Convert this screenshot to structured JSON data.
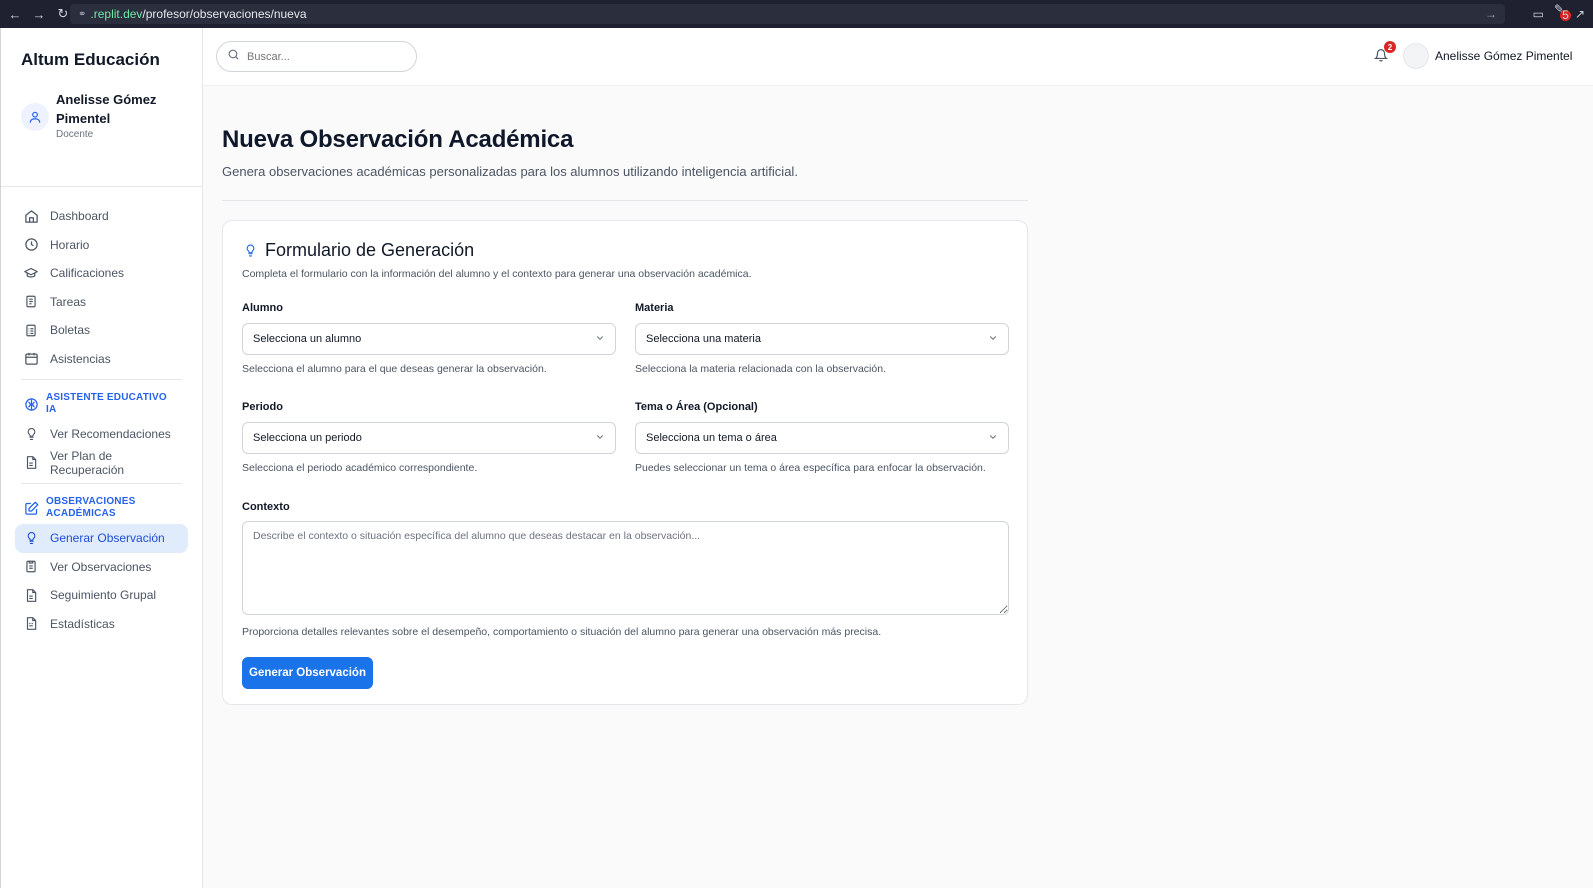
{
  "browser": {
    "url_host": ".replit.dev",
    "url_path": "/profesor/observaciones/nueva",
    "extension_badge": "5"
  },
  "sidebar": {
    "brand": "Altum Educación",
    "profile": {
      "name": "Anelisse Gómez Pimentel",
      "role": "Docente"
    },
    "main_items": [
      {
        "label": "Dashboard",
        "icon": "home-icon"
      },
      {
        "label": "Horario",
        "icon": "clock-icon"
      },
      {
        "label": "Calificaciones",
        "icon": "graduation-cap-icon"
      },
      {
        "label": "Tareas",
        "icon": "clipboard-icon"
      },
      {
        "label": "Boletas",
        "icon": "clipboard-list-icon"
      },
      {
        "label": "Asistencias",
        "icon": "calendar-icon"
      }
    ],
    "ai_section": {
      "title": "ASISTENTE EDUCATIVO IA",
      "items": [
        {
          "label": "Ver Recomendaciones",
          "icon": "lightbulb-icon"
        },
        {
          "label": "Ver Plan de Recuperación",
          "icon": "file-icon"
        }
      ]
    },
    "obs_section": {
      "title": "OBSERVACIONES ACADÉMICAS",
      "items": [
        {
          "label": "Generar Observación",
          "icon": "lightbulb-icon",
          "active": true
        },
        {
          "label": "Ver Observaciones",
          "icon": "clipboard-list-icon"
        },
        {
          "label": "Seguimiento Grupal",
          "icon": "file-icon"
        },
        {
          "label": "Estadísticas",
          "icon": "file-text-icon"
        }
      ]
    }
  },
  "header": {
    "search_placeholder": "Buscar...",
    "notification_count": "2",
    "user_name": "Anelisse Gómez Pimentel"
  },
  "main": {
    "title": "Nueva Observación Académica",
    "subtitle": "Genera observaciones académicas personalizadas para los alumnos utilizando inteligencia artificial.",
    "card": {
      "title": "Formulario de Generación",
      "description": "Completa el formulario con la información del alumno y el contexto para generar una observación académica.",
      "fields": {
        "alumno": {
          "label": "Alumno",
          "value": "Selecciona un alumno",
          "helper": "Selecciona el alumno para el que deseas generar la observación."
        },
        "materia": {
          "label": "Materia",
          "value": "Selecciona una materia",
          "helper": "Selecciona la materia relacionada con la observación."
        },
        "periodo": {
          "label": "Periodo",
          "value": "Selecciona un periodo",
          "helper": "Selecciona el periodo académico correspondiente."
        },
        "tema": {
          "label": "Tema o Área (Opcional)",
          "value": "Selecciona un tema o área",
          "helper": "Puedes seleccionar un tema o área específica para enfocar la observación."
        }
      },
      "context": {
        "label": "Contexto",
        "placeholder": "Describe el contexto o situación específica del alumno que deseas destacar en la observación...",
        "helper": "Proporciona detalles relevantes sobre el desempeño, comportamiento o situación del alumno para generar una observación más precisa."
      },
      "submit_label": "Generar Observación"
    }
  },
  "colors": {
    "accent": "#1a73e8",
    "active_bg": "#e0ecfb",
    "section_title": "#2563eb",
    "badge": "#dc2626"
  }
}
